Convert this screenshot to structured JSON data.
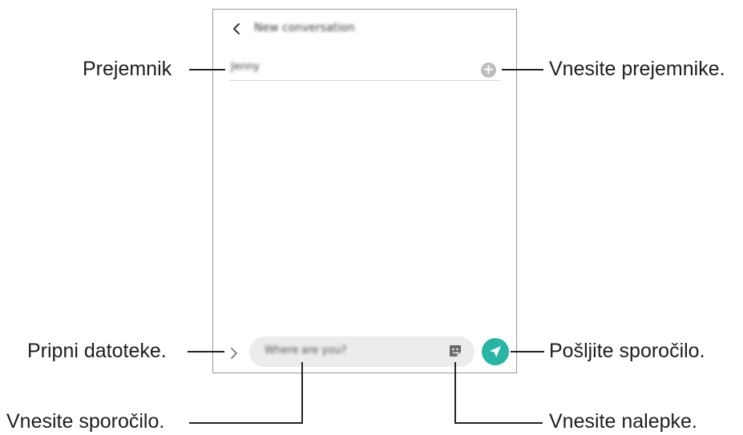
{
  "header": {
    "back_icon": "chevron-left-icon",
    "title": "New conversation"
  },
  "recipient": {
    "value": "Jenny",
    "add_icon": "plus-circle-icon"
  },
  "composer": {
    "attach_icon": "chevron-right-icon",
    "placeholder": "Where are you?",
    "sticker_icon": "sticker-icon",
    "send_icon": "send-arrow-icon",
    "send_color": "#29b5a3"
  },
  "callouts": {
    "recipient": "Prejemnik",
    "add_recipients": "Vnesite prejemnike.",
    "attach_files": "Pripni datoteke.",
    "send_message": "Pošljite sporočilo.",
    "enter_message": "Vnesite sporočilo.",
    "enter_stickers": "Vnesite nalepke."
  }
}
